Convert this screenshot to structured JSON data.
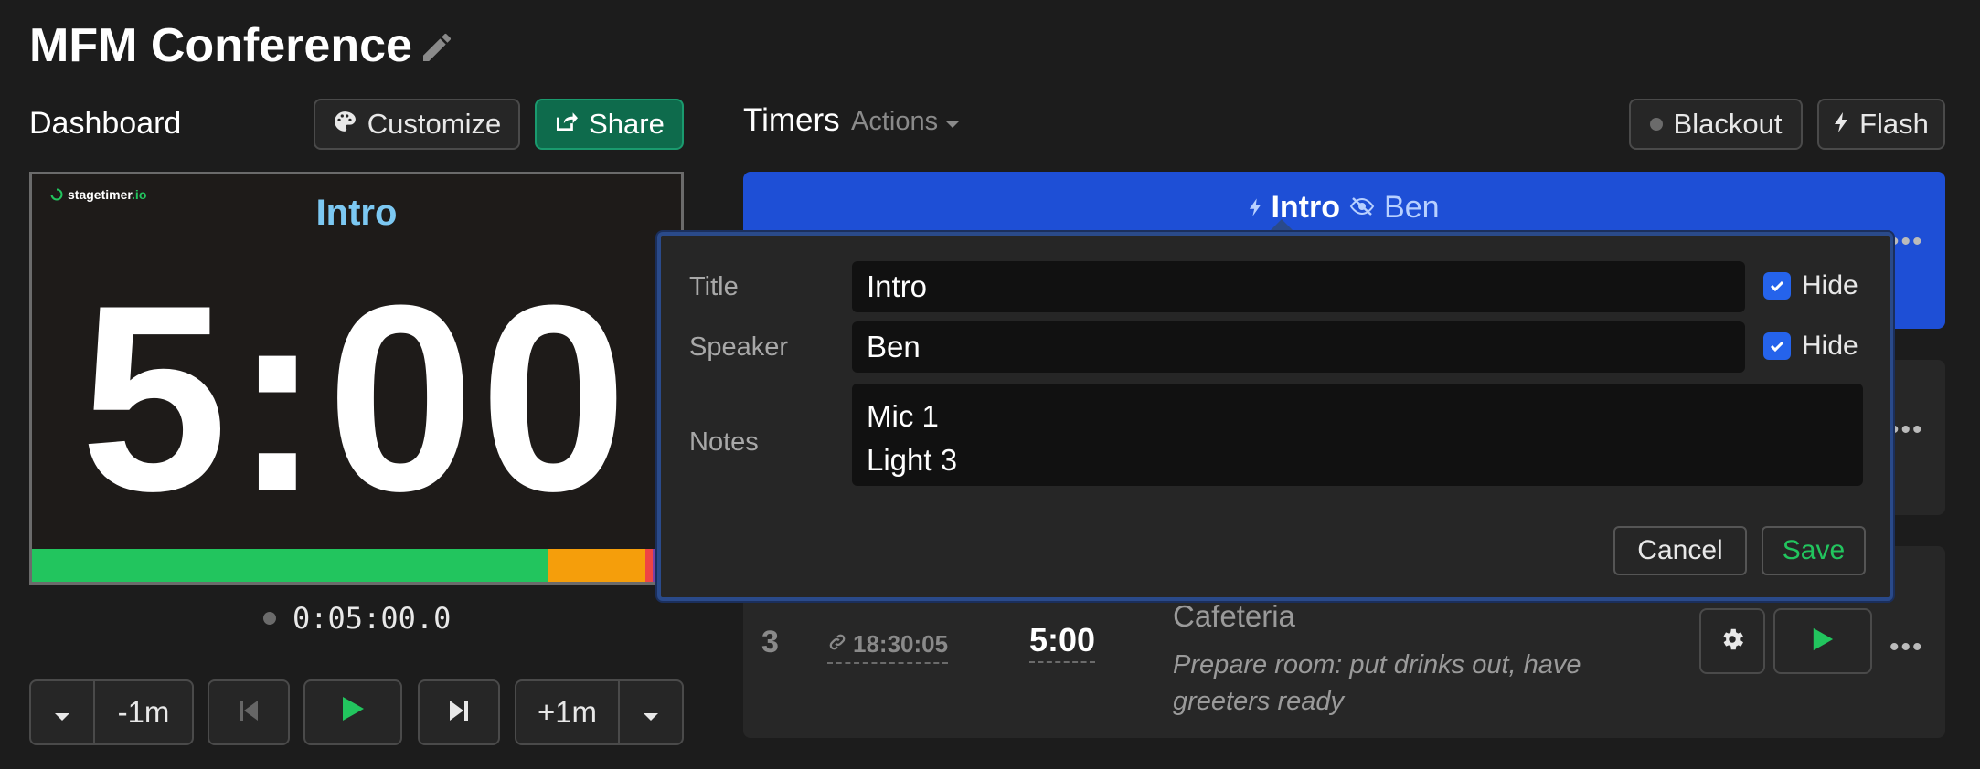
{
  "page": {
    "title": "MFM Conference"
  },
  "dashboard": {
    "title": "Dashboard",
    "customize_label": "Customize",
    "share_label": "Share",
    "preview": {
      "logo": "stagetimer",
      "logo_suffix": ".io",
      "title": "Intro",
      "clock": "5:00",
      "progress": {
        "green": 0.795,
        "orange": 0.15,
        "red": 0.012,
        "purple": 0.043
      }
    },
    "elapsed": "0:05:00.0",
    "controls": {
      "minus_label": "-1m",
      "plus_label": "+1m"
    }
  },
  "timers": {
    "title": "Timers",
    "actions_label": "Actions",
    "blackout_label": "Blackout",
    "flash_label": "Flash",
    "active": {
      "title": "Intro",
      "speaker": "Ben"
    },
    "row3": {
      "number": "3",
      "start": "18:30:05",
      "duration": "5:00",
      "title": "Cafeteria",
      "notes": "Prepare room: put drinks out, have greeters ready"
    }
  },
  "editor": {
    "title_label": "Title",
    "title_value": "Intro",
    "speaker_label": "Speaker",
    "speaker_value": "Ben",
    "notes_label": "Notes",
    "notes_line1": "Mic 1",
    "notes_line2": "Light 3",
    "hide_label": "Hide",
    "cancel_label": "Cancel",
    "save_label": "Save"
  },
  "colors": {
    "background": "#1c1c1c",
    "accent_blue": "#1e4fd6",
    "share_green": "#0e6b4c",
    "play_green": "#22c55e",
    "preview_title": "#7cc8f2"
  }
}
